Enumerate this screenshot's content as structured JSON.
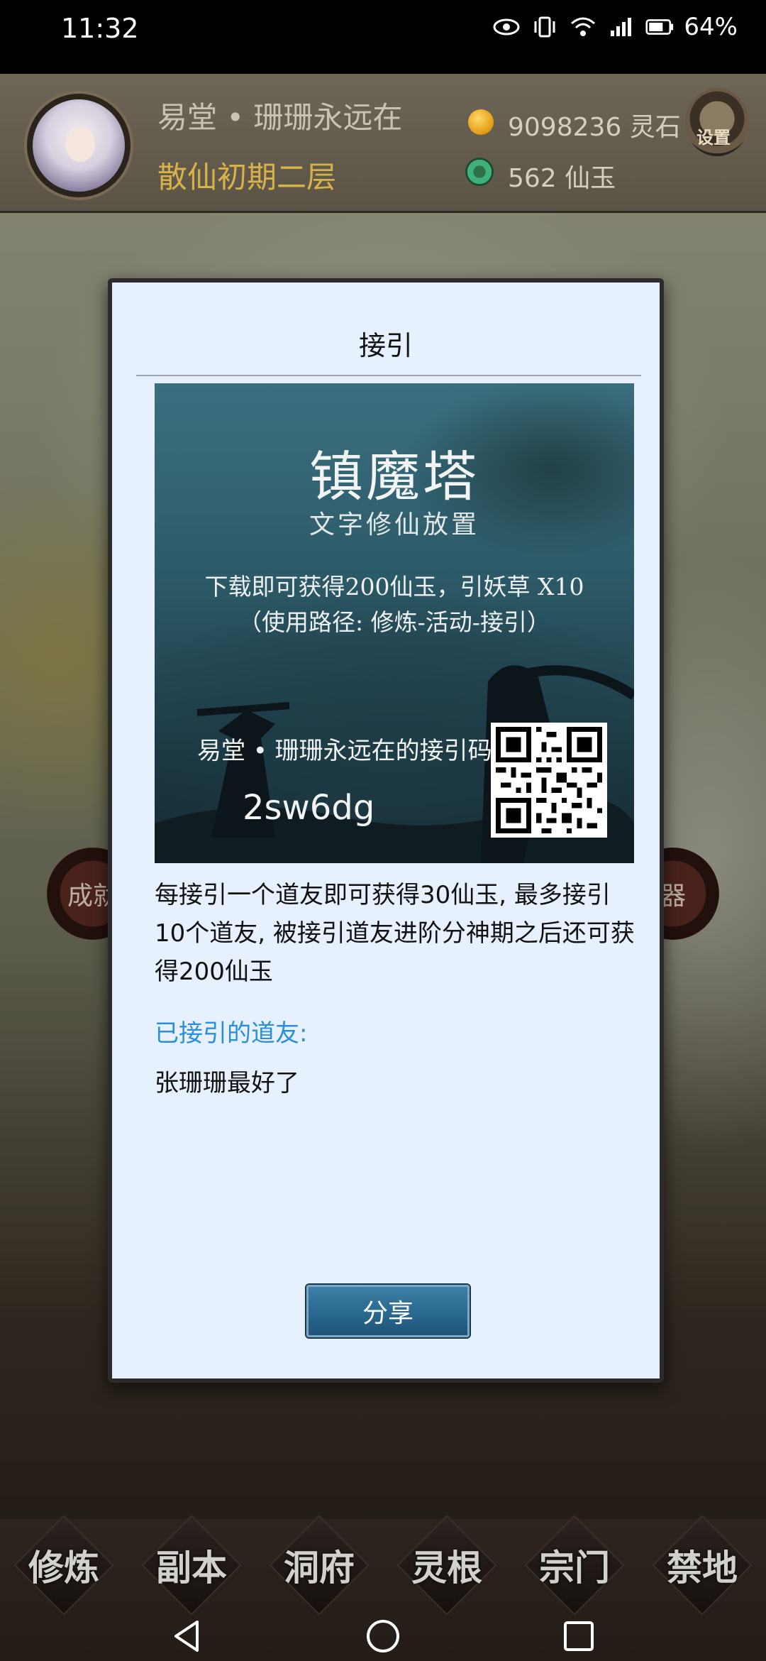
{
  "status_bar": {
    "time": "11:32",
    "battery": "64%"
  },
  "player": {
    "name": "易堂 • 珊珊永远在",
    "realm": "散仙初期二层",
    "spirit_stone": "9098236 灵石",
    "immortal_jade": "562 仙玉",
    "settings_label": "设置"
  },
  "side_buttons": {
    "left_label": "成就",
    "right_label": "器"
  },
  "modal": {
    "title": "接引",
    "poster": {
      "title": "镇魔塔",
      "subtitle": "文字修仙放置",
      "line1": "下载即可获得200仙玉，引妖草 X10",
      "line2": "（使用路径: 修炼-活动-接引）",
      "inviter": "易堂 • 珊珊永远在的接引码",
      "code": "2sw6dg"
    },
    "description": "每接引一个道友即可获得30仙玉, 最多接引10个道友, 被接引道友进阶分神期之后还可获得200仙玉",
    "invited_label": "已接引的道友:",
    "invited_friends": [
      "张珊珊最好了"
    ],
    "share_button": "分享"
  },
  "bottom_nav": [
    "修炼",
    "副本",
    "洞府",
    "灵根",
    "宗门",
    "禁地"
  ],
  "colors": {
    "accent_blue": "#2a8ed8",
    "realm_gold": "#d7b24a",
    "modal_bg": "#e7f1fd"
  }
}
